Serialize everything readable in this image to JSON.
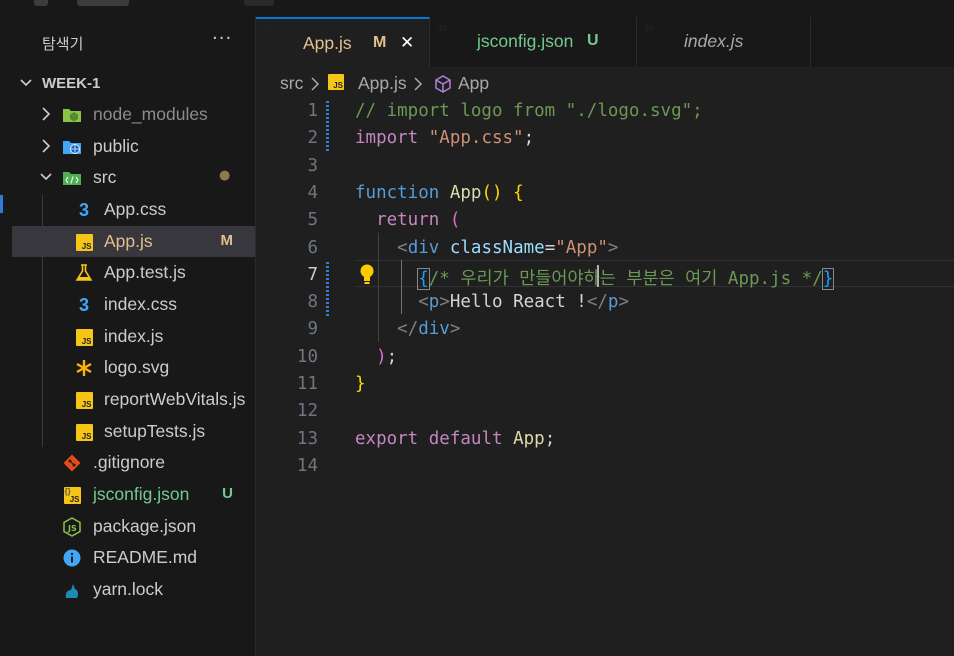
{
  "explorer": {
    "title": "탐색기",
    "more": "···",
    "root": "WEEK-1",
    "items": [
      {
        "label": "node_modules",
        "kind": "folder",
        "dim": true
      },
      {
        "label": "public",
        "kind": "folder"
      },
      {
        "label": "src",
        "kind": "folder-open",
        "dot": "●"
      },
      {
        "label": "App.css",
        "kind": "css"
      },
      {
        "label": "App.js",
        "kind": "js",
        "badge": "M"
      },
      {
        "label": "App.test.js",
        "kind": "test"
      },
      {
        "label": "index.css",
        "kind": "css"
      },
      {
        "label": "index.js",
        "kind": "js"
      },
      {
        "label": "logo.svg",
        "kind": "svg"
      },
      {
        "label": "reportWebVitals.js",
        "kind": "js"
      },
      {
        "label": "setupTests.js",
        "kind": "js"
      },
      {
        "label": ".gitignore",
        "kind": "git"
      },
      {
        "label": "jsconfig.json",
        "kind": "json",
        "badge": "U"
      },
      {
        "label": "package.json",
        "kind": "node"
      },
      {
        "label": "README.md",
        "kind": "info"
      },
      {
        "label": "yarn.lock",
        "kind": "yarn"
      }
    ]
  },
  "tabs": [
    {
      "label": "App.js",
      "badge": "M",
      "close": "✕"
    },
    {
      "label": "jsconfig.json",
      "badge": "U"
    },
    {
      "label": "index.js"
    }
  ],
  "breadcrumb": [
    "src",
    "App.js",
    "App"
  ],
  "editor": {
    "line_numbers": [
      "1",
      "2",
      "3",
      "4",
      "5",
      "6",
      "7",
      "8",
      "9",
      "10",
      "11",
      "12",
      "13",
      "14"
    ],
    "current_line": 7
  },
  "colors": {
    "accent": "#0078d4",
    "modified": "#e2c08d",
    "untracked": "#73c991",
    "js": "#f5c518"
  }
}
